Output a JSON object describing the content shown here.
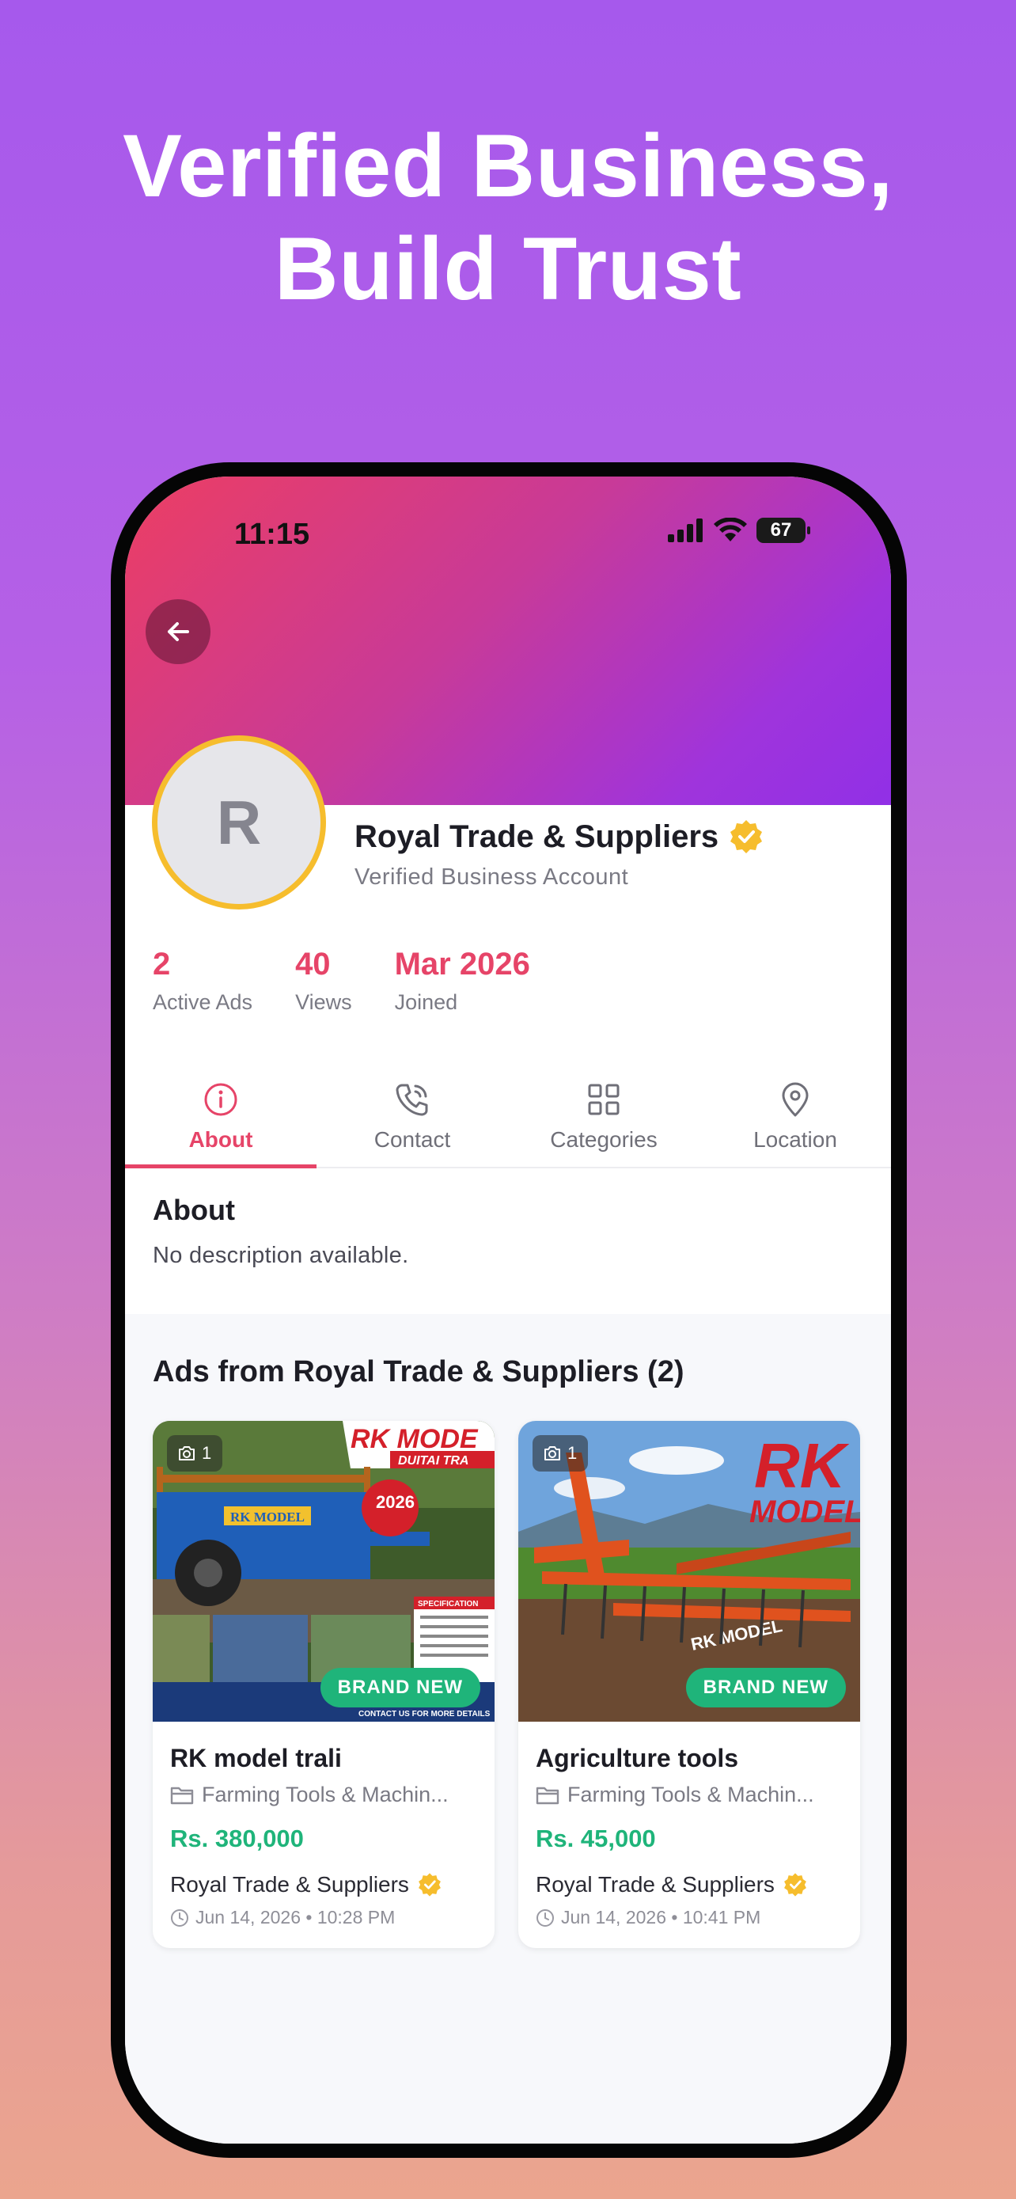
{
  "headline": {
    "line1": "Verified Business,",
    "line2": "Build Trust"
  },
  "status_bar": {
    "time": "11:15",
    "battery": "67"
  },
  "profile": {
    "avatar_initial": "R",
    "name": "Royal Trade & Suppliers",
    "subtitle": "Verified Business Account",
    "verified_icon": "verified-badge-icon"
  },
  "stats": [
    {
      "value": "2",
      "label": "Active Ads"
    },
    {
      "value": "40",
      "label": "Views"
    },
    {
      "value": "Mar 2026",
      "label": "Joined"
    }
  ],
  "tabs": [
    {
      "label": "About",
      "icon": "info-icon",
      "active": true
    },
    {
      "label": "Contact",
      "icon": "phone-icon",
      "active": false
    },
    {
      "label": "Categories",
      "icon": "grid-icon",
      "active": false
    },
    {
      "label": "Location",
      "icon": "map-pin-icon",
      "active": false
    }
  ],
  "about": {
    "title": "About",
    "text": "No description available."
  },
  "ads": {
    "title": "Ads from Royal Trade & Suppliers (2)",
    "items": [
      {
        "photo_count": "1",
        "badge": "BRAND NEW",
        "title": "RK model trali",
        "category": "Farming Tools & Machin...",
        "price": "Rs. 380,000",
        "seller": "Royal Trade & Suppliers",
        "date": "Jun 14, 2026 • 10:28 PM",
        "image_text": {
          "brand": "RK MODE",
          "sub": "DUITAI TRA",
          "body": "RK MODEL",
          "year": "2026",
          "spec": "SPECIFICATION",
          "cta": "CONTACT US FOR MORE DETAILS"
        }
      },
      {
        "photo_count": "1",
        "badge": "BRAND NEW",
        "title": "Agriculture tools",
        "category": "Farming Tools & Machin...",
        "price": "Rs. 45,000",
        "seller": "Royal Trade & Suppliers",
        "date": "Jun 14, 2026 • 10:41 PM",
        "image_text": {
          "brand": "RK",
          "sub": "MODEL",
          "body": "RK MODEL"
        }
      }
    ]
  },
  "colors": {
    "accent": "#e64468",
    "price": "#1fb47a",
    "verified": "#f6bd2d"
  }
}
